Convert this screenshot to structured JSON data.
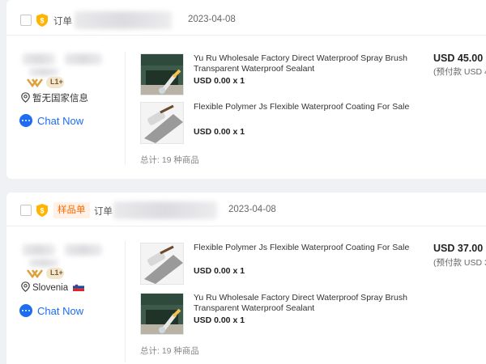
{
  "orders": [
    {
      "order_label": "订单",
      "date": "2023-04-08",
      "seller": {
        "level": "L1+",
        "location": "暂无国家信息",
        "chat_label": "Chat Now"
      },
      "items": [
        {
          "title": "Yu Ru Wholesale Factory Direct Waterproof Spray Brush Transparent Waterproof Sealant",
          "price_qty": "USD 0.00 x 1",
          "thumb": "spray-sealant"
        },
        {
          "title": "Flexible Polymer Js Flexible Waterproof Coating For Sale",
          "price_qty": "USD 0.00 x 1",
          "thumb": "coating-roller"
        }
      ],
      "total_items": "总计: 19 种商品",
      "amount": "USD 45.00",
      "prepay": "(预付款 USD 4"
    },
    {
      "order_label": "订单",
      "sample_tag": "样品单",
      "date": "2023-04-08",
      "seller": {
        "level": "L1+",
        "location": "Slovenia",
        "flag": "🇸🇮",
        "chat_label": "Chat Now"
      },
      "items": [
        {
          "title": "Flexible Polymer Js Flexible Waterproof Coating For Sale",
          "price_qty": "USD 0.00 x 1",
          "thumb": "coating-roller"
        },
        {
          "title": "Yu Ru Wholesale Factory Direct Waterproof Spray Brush Transparent Waterproof Sealant",
          "price_qty": "USD 0.00 x 1",
          "thumb": "spray-sealant"
        }
      ],
      "total_items": "总计: 19 种商品",
      "amount": "USD 37.00",
      "prepay": "(预付款 USD 3"
    }
  ],
  "colors": {
    "accent_blue": "#1e6cf3",
    "accent_orange": "#ff6a00",
    "page_bg": "#f0f1f4"
  }
}
